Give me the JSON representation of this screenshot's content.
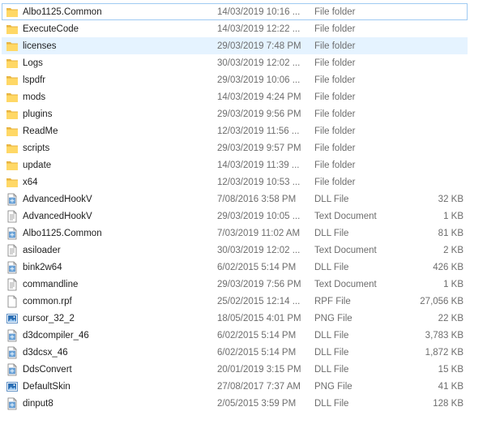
{
  "files": [
    {
      "name": "Albo1125.Common",
      "date": "14/03/2019 10:16 ...",
      "type": "File folder",
      "size": "",
      "icon": "folder-icon",
      "state": "focused"
    },
    {
      "name": "ExecuteCode",
      "date": "14/03/2019 12:22 ...",
      "type": "File folder",
      "size": "",
      "icon": "folder-icon",
      "state": ""
    },
    {
      "name": "licenses",
      "date": "29/03/2019 7:48 PM",
      "type": "File folder",
      "size": "",
      "icon": "folder-icon",
      "state": "hovered"
    },
    {
      "name": "Logs",
      "date": "30/03/2019 12:02 ...",
      "type": "File folder",
      "size": "",
      "icon": "folder-icon",
      "state": ""
    },
    {
      "name": "lspdfr",
      "date": "29/03/2019 10:06 ...",
      "type": "File folder",
      "size": "",
      "icon": "folder-icon",
      "state": ""
    },
    {
      "name": "mods",
      "date": "14/03/2019 4:24 PM",
      "type": "File folder",
      "size": "",
      "icon": "folder-icon",
      "state": ""
    },
    {
      "name": "plugins",
      "date": "29/03/2019 9:56 PM",
      "type": "File folder",
      "size": "",
      "icon": "folder-icon",
      "state": ""
    },
    {
      "name": "ReadMe",
      "date": "12/03/2019 11:56 ...",
      "type": "File folder",
      "size": "",
      "icon": "folder-icon",
      "state": ""
    },
    {
      "name": "scripts",
      "date": "29/03/2019 9:57 PM",
      "type": "File folder",
      "size": "",
      "icon": "folder-icon",
      "state": ""
    },
    {
      "name": "update",
      "date": "14/03/2019 11:39 ...",
      "type": "File folder",
      "size": "",
      "icon": "folder-icon",
      "state": ""
    },
    {
      "name": "x64",
      "date": "12/03/2019 10:53 ...",
      "type": "File folder",
      "size": "",
      "icon": "folder-icon",
      "state": ""
    },
    {
      "name": "AdvancedHookV",
      "date": "7/08/2016 3:58 PM",
      "type": "DLL File",
      "size": "32 KB",
      "icon": "dll-file-icon",
      "state": ""
    },
    {
      "name": "AdvancedHookV",
      "date": "29/03/2019 10:05 ...",
      "type": "Text Document",
      "size": "1 KB",
      "icon": "text-document-icon",
      "state": ""
    },
    {
      "name": "Albo1125.Common",
      "date": "7/03/2019 11:02 AM",
      "type": "DLL File",
      "size": "81 KB",
      "icon": "dll-file-icon",
      "state": ""
    },
    {
      "name": "asiloader",
      "date": "30/03/2019 12:02 ...",
      "type": "Text Document",
      "size": "2 KB",
      "icon": "text-document-icon",
      "state": ""
    },
    {
      "name": "bink2w64",
      "date": "6/02/2015 5:14 PM",
      "type": "DLL File",
      "size": "426 KB",
      "icon": "dll-file-icon",
      "state": ""
    },
    {
      "name": "commandline",
      "date": "29/03/2019 7:56 PM",
      "type": "Text Document",
      "size": "1 KB",
      "icon": "text-document-icon",
      "state": ""
    },
    {
      "name": "common.rpf",
      "date": "25/02/2015 12:14 ...",
      "type": "RPF File",
      "size": "27,056 KB",
      "icon": "blank-file-icon",
      "state": ""
    },
    {
      "name": "cursor_32_2",
      "date": "18/05/2015 4:01 PM",
      "type": "PNG File",
      "size": "22 KB",
      "icon": "png-file-icon",
      "state": ""
    },
    {
      "name": "d3dcompiler_46",
      "date": "6/02/2015 5:14 PM",
      "type": "DLL File",
      "size": "3,783 KB",
      "icon": "dll-file-icon",
      "state": ""
    },
    {
      "name": "d3dcsx_46",
      "date": "6/02/2015 5:14 PM",
      "type": "DLL File",
      "size": "1,872 KB",
      "icon": "dll-file-icon",
      "state": ""
    },
    {
      "name": "DdsConvert",
      "date": "20/01/2019 3:15 PM",
      "type": "DLL File",
      "size": "15 KB",
      "icon": "dll-file-icon",
      "state": ""
    },
    {
      "name": "DefaultSkin",
      "date": "27/08/2017 7:37 AM",
      "type": "PNG File",
      "size": "41 KB",
      "icon": "png-file-icon",
      "state": ""
    },
    {
      "name": "dinput8",
      "date": "2/05/2015 3:59 PM",
      "type": "DLL File",
      "size": "128 KB",
      "icon": "dll-file-icon",
      "state": ""
    }
  ]
}
